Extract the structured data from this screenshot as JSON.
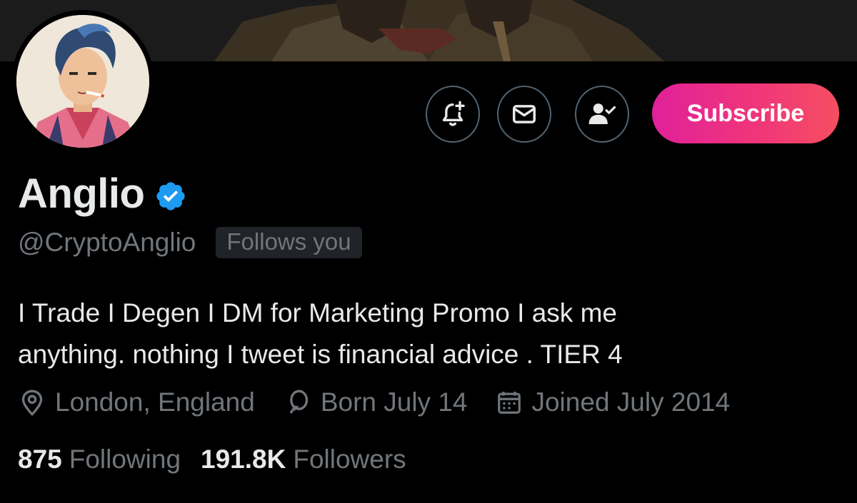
{
  "profile": {
    "display_name": "Anglio",
    "handle": "@CryptoAnglio",
    "follows_you": "Follows you",
    "bio_line1": "I Trade I Degen I DM for Marketing Promo I ask me",
    "bio_line2": "anything. nothing I tweet is financial advice . TIER 4",
    "verified": true
  },
  "meta": {
    "location": "London, England",
    "birthday": "Born July 14",
    "joined": "Joined July 2014"
  },
  "stats": {
    "following_count": "875",
    "following_label": "Following",
    "followers_count": "191.8K",
    "followers_label": "Followers"
  },
  "actions": {
    "notify_icon": "bell-plus-icon",
    "message_icon": "mail-icon",
    "following_icon": "person-check-icon",
    "subscribe_label": "Subscribe"
  },
  "colors": {
    "background": "#000000",
    "text_primary": "#e7e9ea",
    "text_secondary": "#71767b",
    "verified_blue": "#1d9bf0",
    "subscribe_gradient_start": "#e0219a",
    "subscribe_gradient_end": "#f54f61",
    "icon_button_border": "#536471"
  }
}
